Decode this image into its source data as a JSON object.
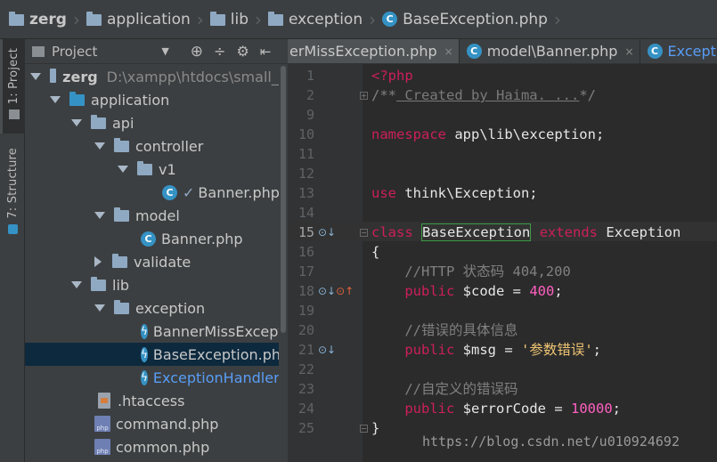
{
  "breadcrumb": {
    "items": [
      "zerg",
      "application",
      "lib",
      "exception",
      "BaseException.php"
    ]
  },
  "left_strip": {
    "project_tab": "1: Project",
    "structure_tab": "7: Structure"
  },
  "project_panel": {
    "title": "Project",
    "root": "zerg",
    "root_path": "D:\\xampp\\htdocs\\small_p",
    "tree": [
      {
        "label": "application"
      },
      {
        "label": "api"
      },
      {
        "label": "controller"
      },
      {
        "label": "v1"
      },
      {
        "label": "Banner.php"
      },
      {
        "label": "model"
      },
      {
        "label": "Banner.php"
      },
      {
        "label": "validate"
      },
      {
        "label": "lib"
      },
      {
        "label": "exception"
      },
      {
        "label": "BannerMissExcepti"
      },
      {
        "label": "BaseException.php"
      },
      {
        "label": "ExceptionHandler.p"
      },
      {
        "label": ".htaccess"
      },
      {
        "label": "command.php"
      },
      {
        "label": "common.php"
      }
    ]
  },
  "editor_tabs": [
    "erMissException.php",
    "model\\Banner.php",
    "Exception"
  ],
  "editor": {
    "line_numbers": [
      "1",
      "2",
      "9",
      "10",
      "11",
      "12",
      "13",
      "14",
      "15",
      "16",
      "17",
      "18",
      "19",
      "20",
      "21",
      "22",
      "23",
      "24",
      "25"
    ],
    "current_line": "15",
    "code": {
      "l1": "<?php",
      "l2_open": "/**",
      "l2_folded": " Created by Haima. ...",
      "l2_close": "*/",
      "l10_kw": "namespace",
      "l10_rest": " app\\lib\\exception;",
      "l13_kw": "use",
      "l13_rest": " think\\Exception;",
      "l15_kw": "class",
      "l15_name": "BaseException",
      "l15_kw2": "extends",
      "l15_parent": "Exception",
      "l16": "{",
      "l17": "    //HTTP 状态码 404,200",
      "l18_kw": "public",
      "l18_var": "$code",
      "l18_eq": " = ",
      "l18_val": "400",
      "l18_end": ";",
      "l20": "    //错误的具体信息",
      "l21_kw": "public",
      "l21_var": "$msg",
      "l21_eq": " = ",
      "l21_val": "'参数错误'",
      "l21_end": ";",
      "l23": "    //自定义的错误码",
      "l24_kw": "public",
      "l24_var": "$errorCode",
      "l24_eq": " = ",
      "l24_val": "10000",
      "l24_end": ";",
      "l25": "}"
    }
  },
  "watermark": "https://blog.csdn.net/u010924692",
  "icons": {
    "folder": "folder-icon",
    "class": "class-icon",
    "php": "php-file-icon"
  }
}
